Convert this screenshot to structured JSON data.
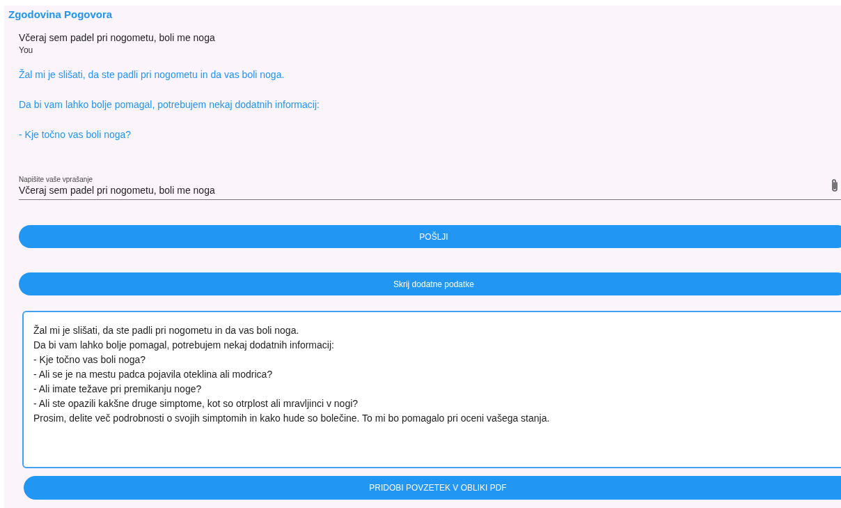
{
  "title": "Zgodovina Pogovora",
  "messages": [
    {
      "kind": "user",
      "text": "Včeraj sem padel pri nogometu, boli me noga",
      "sender": "You"
    },
    {
      "kind": "assistant",
      "paragraphs": [
        "Žal mi je slišati, da ste padli pri nogometu in da vas boli noga.",
        "Da bi vam lahko bolje pomagal, potrebujem nekaj dodatnih informacij:",
        "- Kje točno vas boli noga?"
      ]
    }
  ],
  "question_field": {
    "label": "Napišite vaše vprašanje",
    "value": "Včeraj sem padel pri nogometu, boli me noga"
  },
  "send_button": "POŠLJI",
  "toggle_button": "Skrij dodatne podatke",
  "summary": {
    "lines": [
      "Žal mi je slišati, da ste padli pri nogometu in da vas boli noga.",
      "Da bi vam lahko bolje pomagal, potrebujem nekaj dodatnih informacij:",
      "- Kje točno vas boli noga?",
      "- Ali se je na mestu padca pojavila oteklina ali modrica?",
      "- Ali imate težave pri premikanju noge?",
      "- Ali ste opazili kakšne druge simptome, kot so otrplost ali mravljinci v nogi?",
      "Prosim, delite več podrobnosti o svojih simptomih in kako hude so bolečine. To mi bo pomagalo pri oceni vašega stanja."
    ]
  },
  "pdf_button": "PRIDOBI POVZETEK V OBLIKI PDF"
}
